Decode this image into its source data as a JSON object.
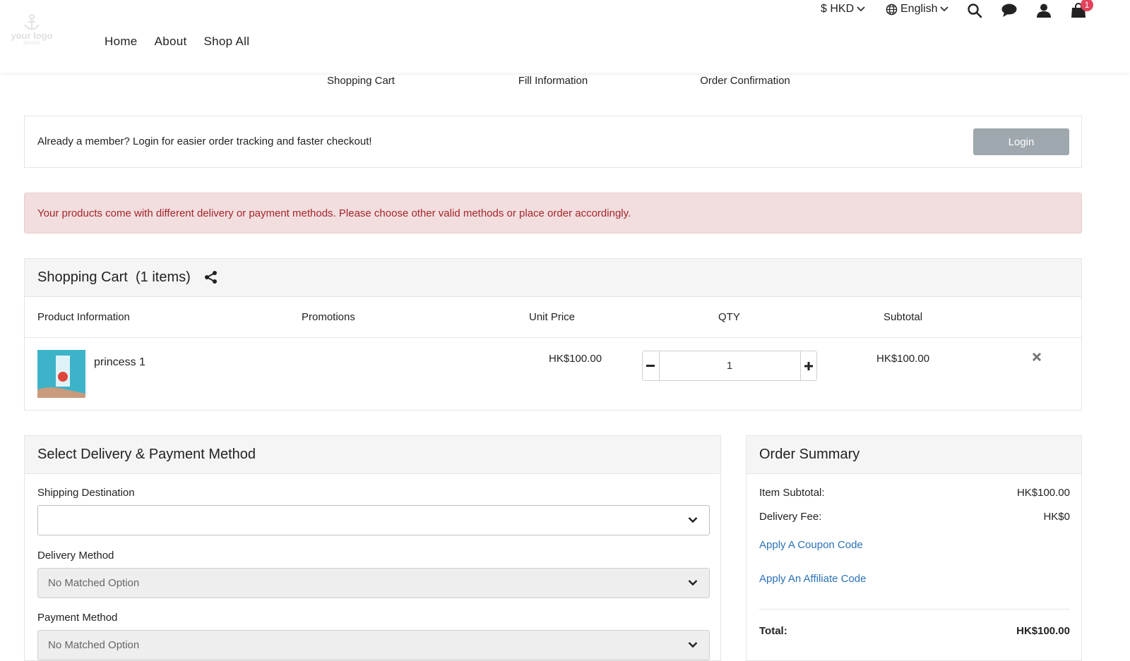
{
  "header": {
    "logo": {
      "text": "your logo",
      "sub": "商店名称"
    },
    "nav": [
      {
        "label": "Home"
      },
      {
        "label": "About"
      },
      {
        "label": "Shop All"
      }
    ],
    "currency": "$ HKD",
    "language": "English",
    "cart_count": "1",
    "icons": [
      "search-icon",
      "chat-icon",
      "user-icon",
      "cart-icon"
    ]
  },
  "steps": [
    {
      "label": "Shopping Cart"
    },
    {
      "label": "Fill Information"
    },
    {
      "label": "Order Confirmation"
    }
  ],
  "login_prompt": {
    "message": "Already a member? Login for easier order tracking and faster checkout!",
    "button": "Login"
  },
  "alert": {
    "message": "Your products come with different delivery or payment methods. Please choose other valid methods or place order accordingly."
  },
  "cart": {
    "title": "Shopping Cart",
    "count_label": "(1 items)",
    "columns": {
      "product": "Product Information",
      "promotions": "Promotions",
      "unit_price": "Unit Price",
      "qty": "QTY",
      "subtotal": "Subtotal"
    },
    "items": [
      {
        "name": "princess 1",
        "unit_price": "HK$100.00",
        "qty": "1",
        "subtotal": "HK$100.00"
      }
    ]
  },
  "delivery": {
    "title": "Select Delivery & Payment Method",
    "shipping_label": "Shipping Destination",
    "shipping_value": "",
    "delivery_label": "Delivery Method",
    "delivery_value": "No Matched Option",
    "payment_label": "Payment Method",
    "payment_value": "No Matched Option"
  },
  "summary": {
    "title": "Order Summary",
    "item_subtotal_label": "Item Subtotal:",
    "item_subtotal_value": "HK$100.00",
    "delivery_fee_label": "Delivery Fee:",
    "delivery_fee_value": "HK$0",
    "coupon_link": "Apply A Coupon Code",
    "affiliate_link": "Apply An Affiliate Code",
    "total_label": "Total:",
    "total_value": "HK$100.00"
  },
  "colors": {
    "alert_bg": "#f2dedf",
    "alert_text": "#a3262b",
    "login_button": "#9ea8ae",
    "link": "#2b72b8",
    "badge": "#e2445c"
  }
}
